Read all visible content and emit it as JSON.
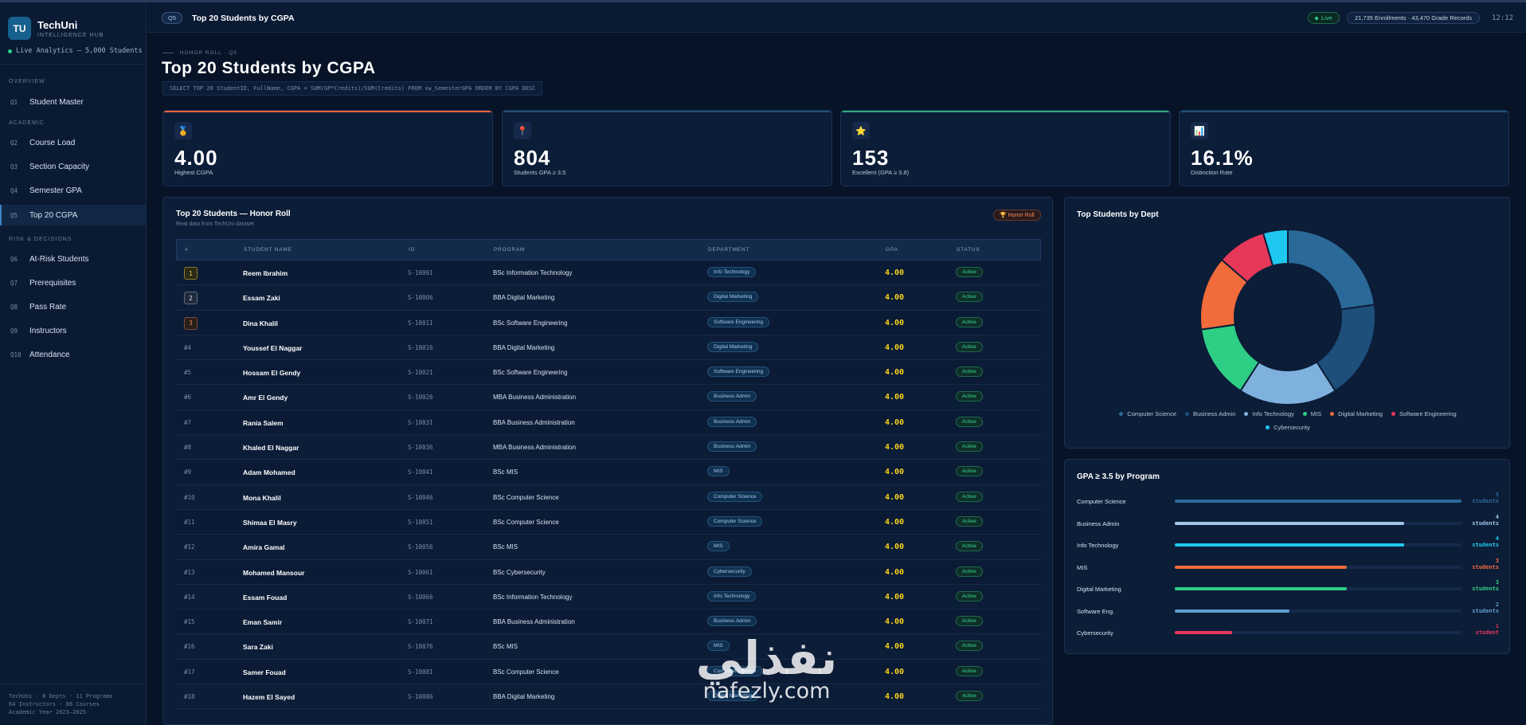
{
  "brand": {
    "logo": "TU",
    "name": "TechUni",
    "subtitle": "INTELLIGENCE HUB",
    "live_line": "Live Analytics — 5,000 Students"
  },
  "sidebar": {
    "sections": [
      "OVERVIEW",
      "ACADEMIC",
      "RISK & DECISIONS"
    ],
    "items": [
      {
        "num": "Q1",
        "label": "Student Master"
      },
      {
        "num": "Q2",
        "label": "Course Load"
      },
      {
        "num": "Q3",
        "label": "Section Capacity"
      },
      {
        "num": "Q4",
        "label": "Semester GPA"
      },
      {
        "num": "Q5",
        "label": "Top 20 CGPA"
      },
      {
        "num": "Q6",
        "label": "At-Risk Students"
      },
      {
        "num": "Q7",
        "label": "Prerequisites"
      },
      {
        "num": "Q8",
        "label": "Pass Rate"
      },
      {
        "num": "Q9",
        "label": "Instructors"
      },
      {
        "num": "Q10",
        "label": "Attendance"
      }
    ],
    "active_index": 4,
    "footer": [
      "TechUni · 8 Depts · 11 Programs",
      "64 Instructors · 88 Courses",
      "Academic Year 2023–2025"
    ]
  },
  "header": {
    "badge": "Q5",
    "title": "Top 20 Students by CGPA",
    "live": "Live",
    "stats": "21,735 Enrollments · 43,470 Grade Records",
    "clock": "12:12"
  },
  "page": {
    "eyebrow": "HONOR ROLL · Q5",
    "title": "Top 20 Students by CGPA",
    "sql": "SELECT TOP 20 StudentID, FullName, CGPA = SUM(GP*Credits)/SUM(Credits) FROM vw_SemesterGPA ORDER BY CGPA DESC"
  },
  "kpis": [
    {
      "icon": "medal-icon",
      "glyph": "🏅",
      "value": "4.00",
      "label": "Highest CGPA",
      "accent": "#e8633a"
    },
    {
      "icon": "pin-icon",
      "glyph": "📍",
      "value": "804",
      "label": "Students GPA ≥ 3.5",
      "accent": "#1f4f7a"
    },
    {
      "icon": "star-icon",
      "glyph": "⭐",
      "value": "153",
      "label": "Excellent (GPA ≥ 3.8)",
      "accent": "#2fae7a"
    },
    {
      "icon": "chart-icon",
      "glyph": "📊",
      "value": "16.1%",
      "label": "Distinction Rate",
      "accent": "#1f4f7a"
    }
  ],
  "table": {
    "title": "Top 20 Students — Honor Roll",
    "subtitle": "Real data from TechUni dataset",
    "badge": "🏆 Honor Roll",
    "columns": [
      "#",
      "STUDENT NAME",
      "ID",
      "PROGRAM",
      "DEPARTMENT",
      "GPA",
      "STATUS"
    ],
    "rows": [
      {
        "rank": "1",
        "name": "Reem Ibrahim",
        "id": "S-10001",
        "program": "BSc Information Technology",
        "dept": "Info Technology",
        "gpa": "4.00",
        "status": "Active"
      },
      {
        "rank": "2",
        "name": "Essam Zaki",
        "id": "S-10006",
        "program": "BBA Digital Marketing",
        "dept": "Digital Marketing",
        "gpa": "4.00",
        "status": "Active"
      },
      {
        "rank": "3",
        "name": "Dina Khalil",
        "id": "S-10011",
        "program": "BSc Software Engineering",
        "dept": "Software Engineering",
        "gpa": "4.00",
        "status": "Active"
      },
      {
        "rank": "#4",
        "name": "Youssef El Naggar",
        "id": "S-10016",
        "program": "BBA Digital Marketing",
        "dept": "Digital Marketing",
        "gpa": "4.00",
        "status": "Active"
      },
      {
        "rank": "#5",
        "name": "Hossam El Gendy",
        "id": "S-10021",
        "program": "BSc Software Engineering",
        "dept": "Software Engineering",
        "gpa": "4.00",
        "status": "Active"
      },
      {
        "rank": "#6",
        "name": "Amr El Gendy",
        "id": "S-10026",
        "program": "MBA Business Administration",
        "dept": "Business Admin",
        "gpa": "4.00",
        "status": "Active"
      },
      {
        "rank": "#7",
        "name": "Rania Salem",
        "id": "S-10031",
        "program": "BBA Business Administration",
        "dept": "Business Admin",
        "gpa": "4.00",
        "status": "Active"
      },
      {
        "rank": "#8",
        "name": "Khaled El Naggar",
        "id": "S-10036",
        "program": "MBA Business Administration",
        "dept": "Business Admin",
        "gpa": "4.00",
        "status": "Active"
      },
      {
        "rank": "#9",
        "name": "Adam Mohamed",
        "id": "S-10041",
        "program": "BSc MIS",
        "dept": "MIS",
        "gpa": "4.00",
        "status": "Active"
      },
      {
        "rank": "#10",
        "name": "Mona Khalil",
        "id": "S-10046",
        "program": "BSc Computer Science",
        "dept": "Computer Science",
        "gpa": "4.00",
        "status": "Active"
      },
      {
        "rank": "#11",
        "name": "Shimaa El Masry",
        "id": "S-10051",
        "program": "BSc Computer Science",
        "dept": "Computer Science",
        "gpa": "4.00",
        "status": "Active"
      },
      {
        "rank": "#12",
        "name": "Amira Gamal",
        "id": "S-10056",
        "program": "BSc MIS",
        "dept": "MIS",
        "gpa": "4.00",
        "status": "Active"
      },
      {
        "rank": "#13",
        "name": "Mohamed Mansour",
        "id": "S-10061",
        "program": "BSc Cybersecurity",
        "dept": "Cybersecurity",
        "gpa": "4.00",
        "status": "Active"
      },
      {
        "rank": "#14",
        "name": "Essam Fouad",
        "id": "S-10066",
        "program": "BSc Information Technology",
        "dept": "Info Technology",
        "gpa": "4.00",
        "status": "Active"
      },
      {
        "rank": "#15",
        "name": "Eman Samir",
        "id": "S-10071",
        "program": "BBA Business Administration",
        "dept": "Business Admin",
        "gpa": "4.00",
        "status": "Active"
      },
      {
        "rank": "#16",
        "name": "Sara Zaki",
        "id": "S-10076",
        "program": "BSc MIS",
        "dept": "MIS",
        "gpa": "4.00",
        "status": "Active"
      },
      {
        "rank": "#17",
        "name": "Samer Fouad",
        "id": "S-10081",
        "program": "BSc Computer Science",
        "dept": "Computer Science",
        "gpa": "4.00",
        "status": "Active"
      },
      {
        "rank": "#18",
        "name": "Hazem El Sayed",
        "id": "S-10086",
        "program": "BBA Digital Marketing",
        "dept": "Digital Marketing",
        "gpa": "4.00",
        "status": "Active"
      }
    ]
  },
  "chart_data": [
    {
      "type": "pie",
      "title": "Top Students by Dept",
      "categories": [
        "Computer Science",
        "Business Admin",
        "Info Technology",
        "MIS",
        "Digital Marketing",
        "Software Engineering",
        "Cybersecurity"
      ],
      "values": [
        5,
        4,
        4,
        3,
        3,
        2,
        1
      ],
      "colors": [
        "#2b6a98",
        "#1d4f7a",
        "#7fb1dd",
        "#2ecf84",
        "#f26b3a",
        "#e8385a",
        "#1fc8ef"
      ],
      "legend": "bottom"
    },
    {
      "type": "bar",
      "title": "GPA ≥ 3.5 by Program",
      "categories": [
        "Computer Science",
        "Business Admin",
        "Info Technology",
        "MIS",
        "Digital Marketing",
        "Software Eng.",
        "Cybersecurity"
      ],
      "values": [
        5,
        4,
        4,
        3,
        3,
        2,
        1
      ],
      "value_labels": [
        [
          "5",
          "students"
        ],
        [
          "4",
          "students"
        ],
        [
          "4",
          "students"
        ],
        [
          "3",
          "students"
        ],
        [
          "3",
          "students"
        ],
        [
          "2",
          "students"
        ],
        [
          "1",
          "student"
        ]
      ],
      "colors": [
        "#2b6a98",
        "#9fc6ea",
        "#1fc8ef",
        "#f26b3a",
        "#2ecf84",
        "#5f9dd0",
        "#e8385a"
      ],
      "xlim": [
        0,
        5
      ]
    }
  ],
  "watermark": {
    "arabic": "نفذلي",
    "latin": "nafezly.com"
  }
}
